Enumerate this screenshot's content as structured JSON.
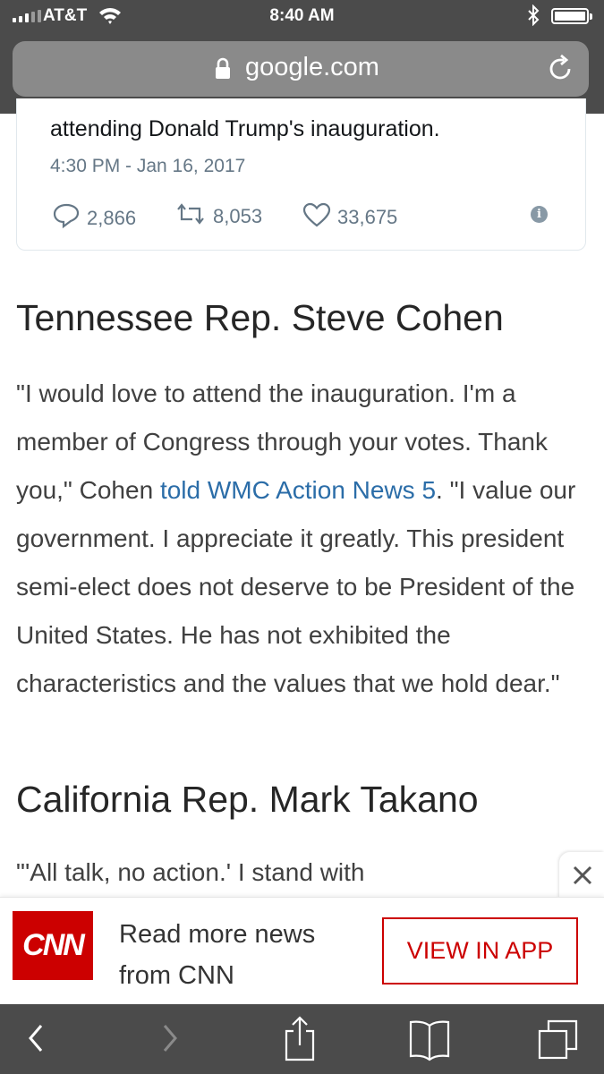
{
  "status_bar": {
    "carrier": "AT&T",
    "time": "8:40 AM",
    "icons": [
      "signal-icon",
      "wifi-icon",
      "bluetooth-icon",
      "battery-icon"
    ]
  },
  "browser": {
    "url": "google.com",
    "icons": [
      "lock-icon",
      "reload-icon"
    ]
  },
  "tweet": {
    "text": "attending Donald Trump's inauguration.",
    "timestamp": "4:30 PM - Jan 16, 2017",
    "replies": "2,866",
    "retweets": "8,053",
    "likes": "33,675",
    "icons": [
      "reply-icon",
      "retweet-icon",
      "like-icon",
      "info-icon"
    ]
  },
  "article": {
    "heading1": "Tennessee Rep. Steve Cohen",
    "para1_before": "\"I would love to attend the inauguration. I'm a member of Congress through your votes. Thank you,\" Cohen ",
    "para1_link": "told WMC Action News 5",
    "para1_after": ". \"I value our government. I appreciate it greatly. This president semi-elect does not deserve to be President of the United States. He has not exhibited the characteristics and the values that we hold dear.\"",
    "heading2": "California Rep. Mark Takano",
    "para2": "\"'All talk, no action.' I stand with"
  },
  "app_banner": {
    "logo_text": "CNN",
    "message": "Read more news from CNN",
    "button": "VIEW IN APP",
    "accent": "#cc0000"
  },
  "toolbar": {
    "icons": [
      "back-icon",
      "forward-icon",
      "share-icon",
      "bookmarks-icon",
      "tabs-icon"
    ]
  }
}
